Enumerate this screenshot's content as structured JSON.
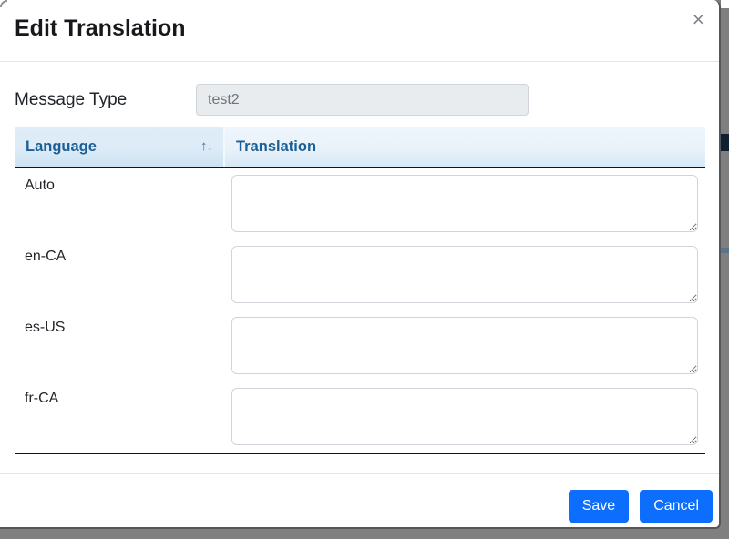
{
  "modal": {
    "title": "Edit Translation",
    "close_icon": "×"
  },
  "form": {
    "message_type_label": "Message Type",
    "message_type_value": "test2"
  },
  "table": {
    "language_header": "Language",
    "translation_header": "Translation",
    "sort_up": "↑",
    "sort_down": "↓",
    "rows": [
      {
        "language": "Auto",
        "translation": ""
      },
      {
        "language": "en-CA",
        "translation": ""
      },
      {
        "language": "es-US",
        "translation": ""
      },
      {
        "language": "fr-CA",
        "translation": ""
      }
    ]
  },
  "footer": {
    "save_label": "Save",
    "cancel_label": "Cancel"
  },
  "colors": {
    "primary_button": "#0d6efd",
    "table_header_bg": "#d9e8f6",
    "table_header_text": "#1c5f94",
    "dark_border": "#121417",
    "disabled_input_bg": "#e9ecef",
    "backdrop": "#7f7f7f"
  }
}
